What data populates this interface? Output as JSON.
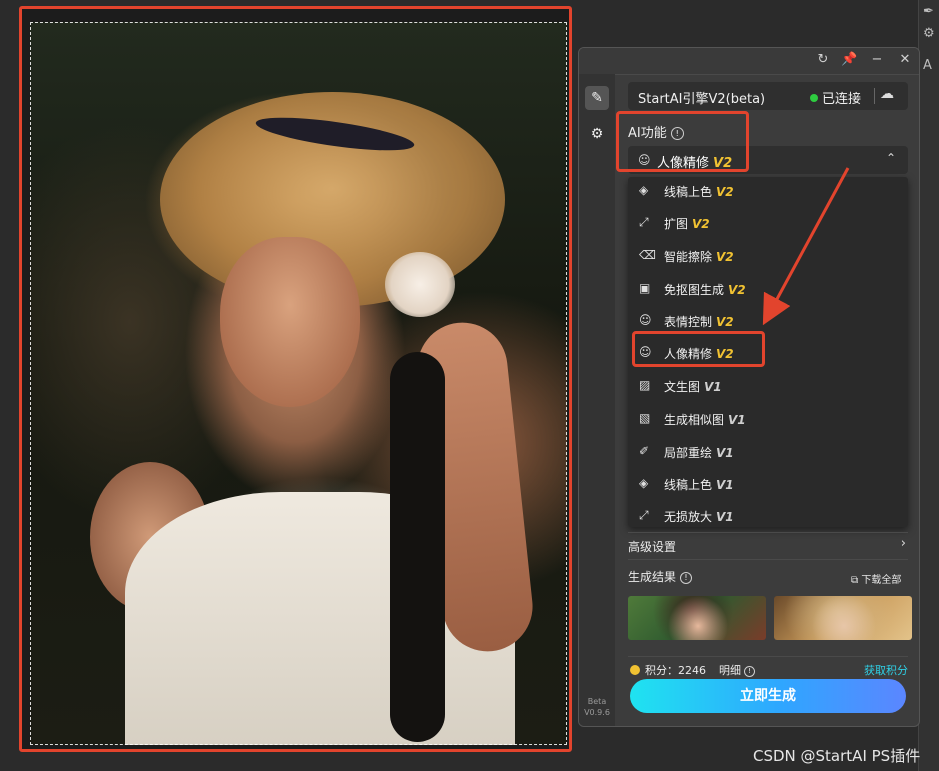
{
  "panel": {
    "title_buttons": [
      "refresh-icon",
      "pin-icon",
      "minimize-icon",
      "close-icon"
    ],
    "engine": {
      "name": "StartAI引擎V2(beta)",
      "status": "已连接",
      "status_color": "#2ecc40"
    },
    "ai_function_label": "AI功能",
    "selected": {
      "label": "人像精修",
      "version": "V2"
    },
    "dropdown_items": [
      {
        "icon": "paint-bucket-icon",
        "label": "线稿上色",
        "version": "V2"
      },
      {
        "icon": "expand-icon",
        "label": "扩图",
        "version": "V2"
      },
      {
        "icon": "eraser-icon",
        "label": "智能擦除",
        "version": "V2"
      },
      {
        "icon": "cutout-icon",
        "label": "免抠图生成",
        "version": "V2"
      },
      {
        "icon": "smiley-icon",
        "label": "表情控制",
        "version": "V2"
      },
      {
        "icon": "portrait-icon",
        "label": "人像精修",
        "version": "V2"
      },
      {
        "icon": "text-image-icon",
        "label": "文生图",
        "version": "V1"
      },
      {
        "icon": "similar-image-icon",
        "label": "生成相似图",
        "version": "V1"
      },
      {
        "icon": "brush-icon",
        "label": "局部重绘",
        "version": "V1"
      },
      {
        "icon": "paint-bucket-icon",
        "label": "线稿上色",
        "version": "V1"
      },
      {
        "icon": "expand-icon",
        "label": "无损放大",
        "version": "V1"
      }
    ],
    "advanced_settings": "高级设置",
    "results_label": "生成结果",
    "download_all": "下载全部",
    "points_label": "积分：",
    "points_value": "2246",
    "detail_label": "明细",
    "get_points": "获取积分",
    "generate_button": "立即生成",
    "version_badge": "Beta",
    "version_number": "V0.9.6",
    "accent_gradient": [
      "#1fe3f0",
      "#5b86ff"
    ]
  },
  "watermark": "CSDN @StartAI PS插件",
  "host_glyphs": [
    "A"
  ]
}
